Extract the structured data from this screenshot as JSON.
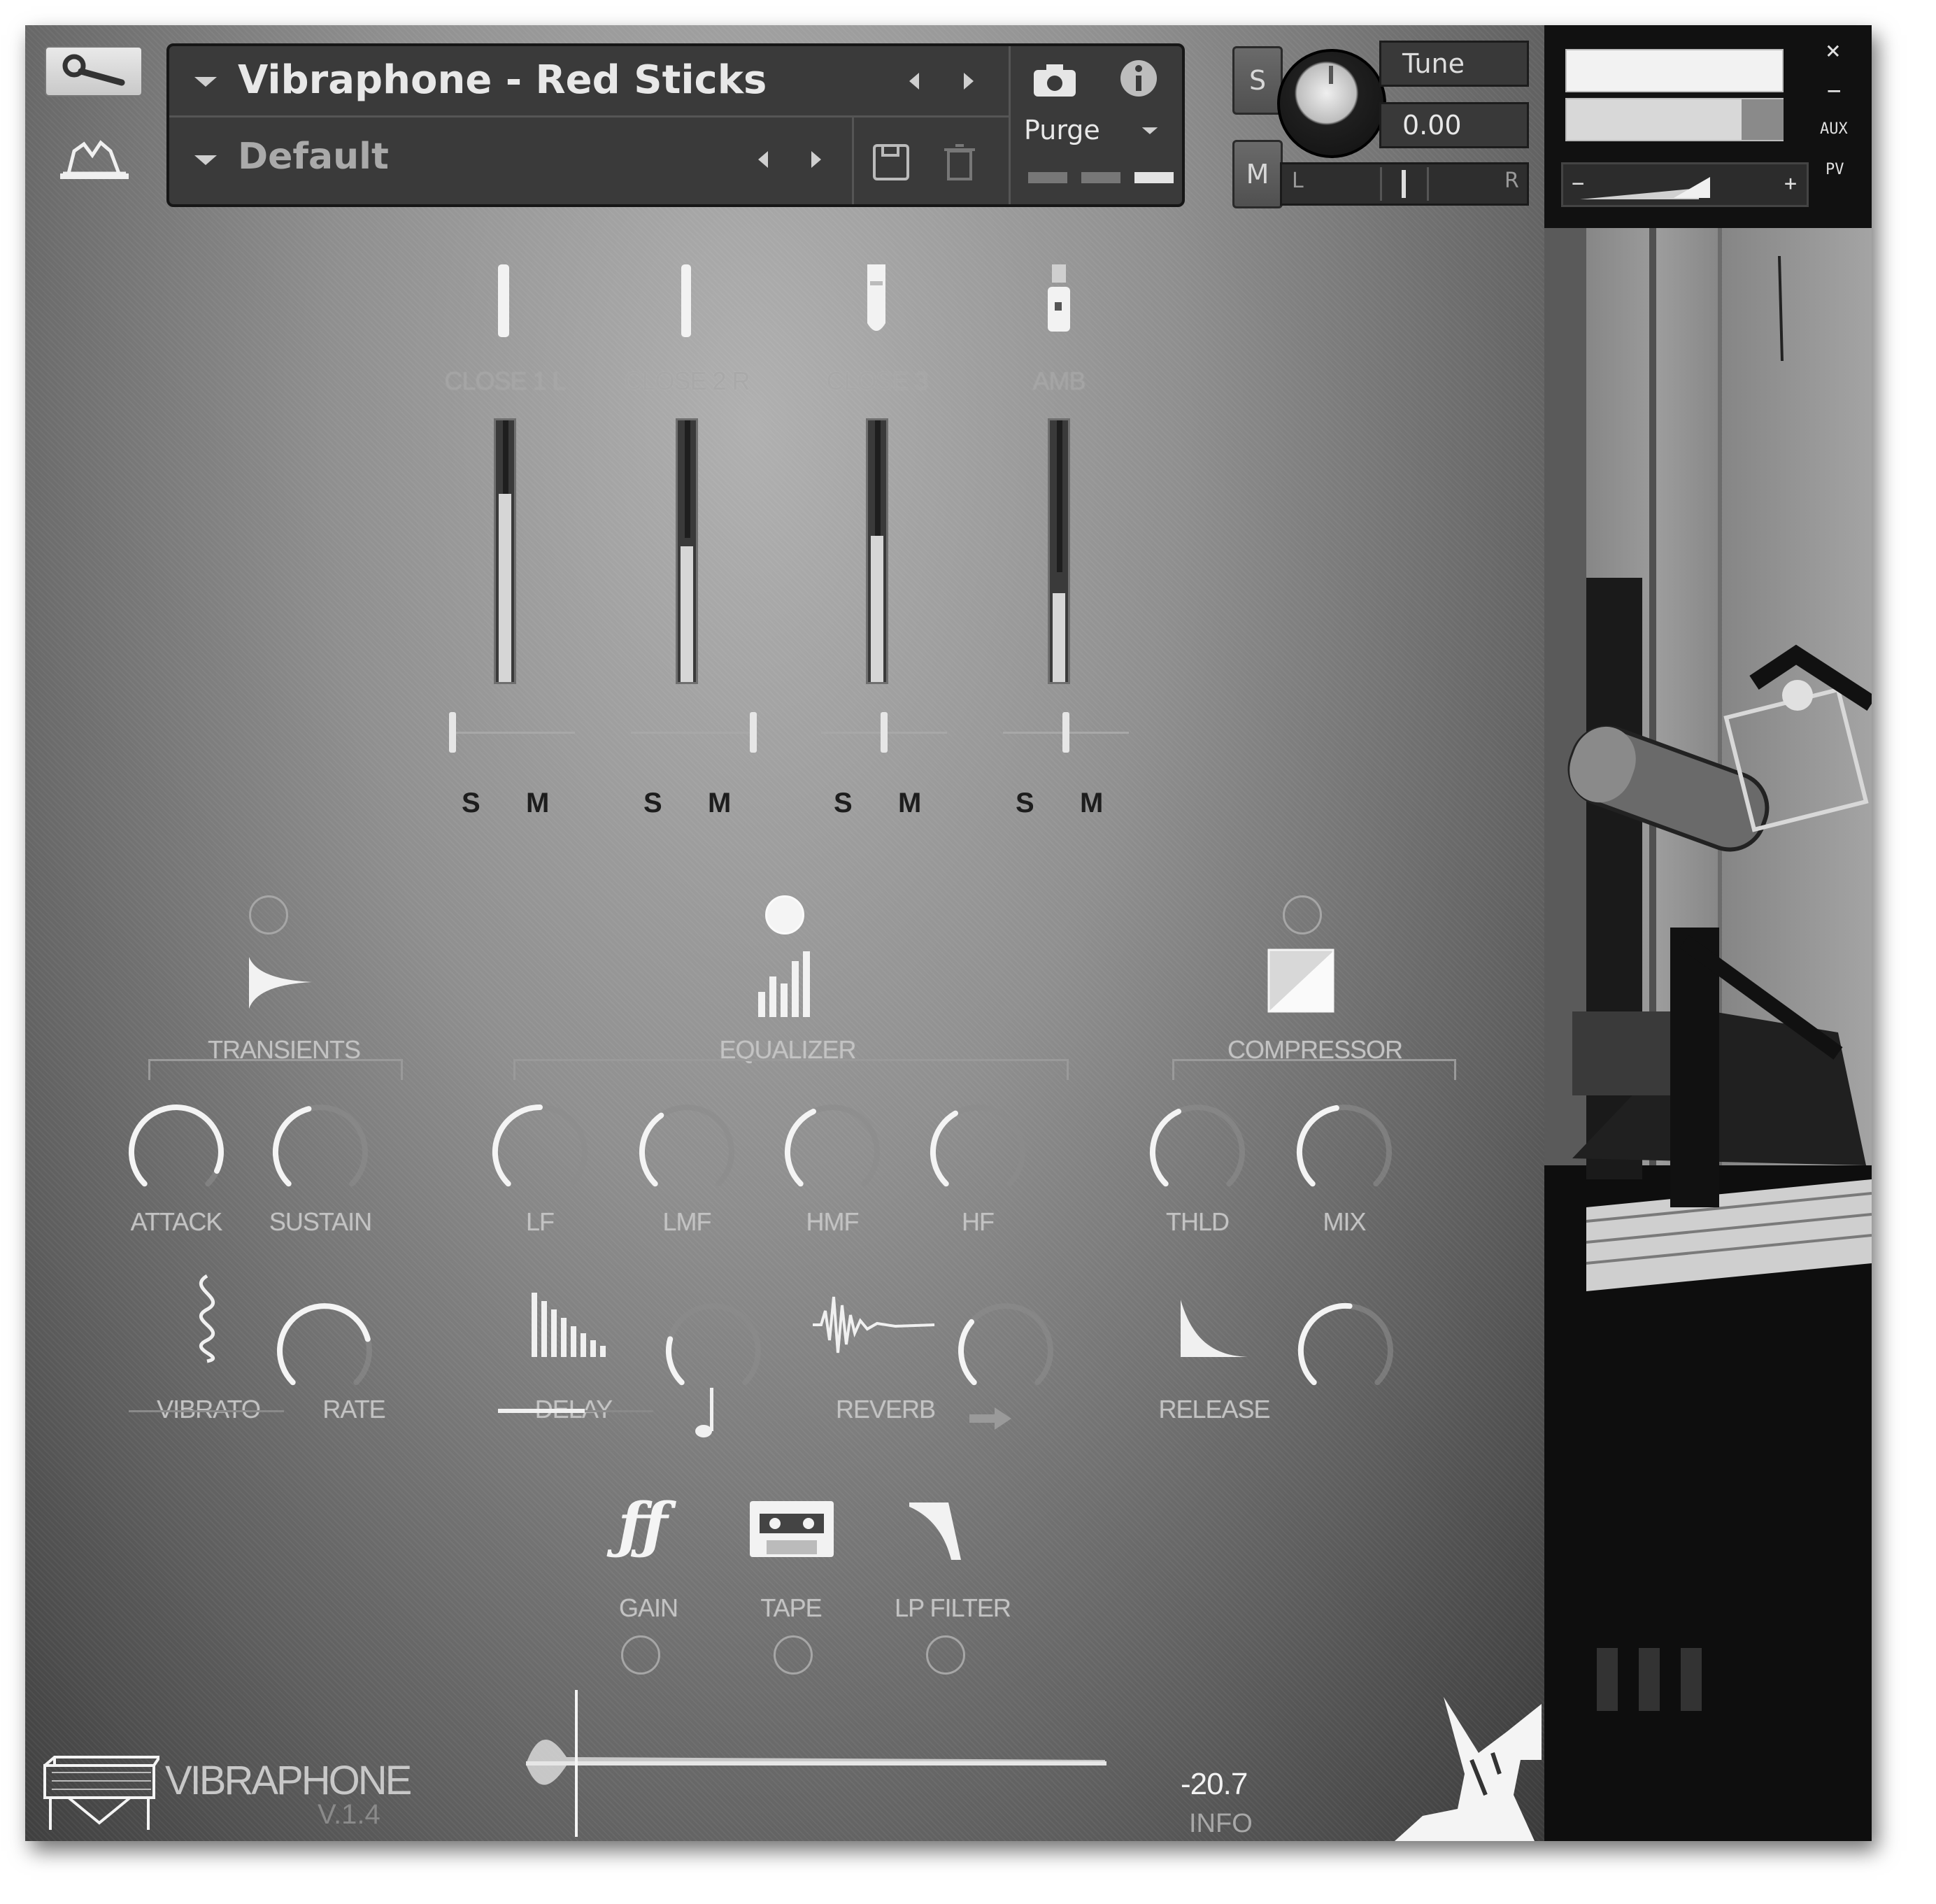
{
  "header": {
    "preset_name": "Vibraphone - Red Sticks",
    "sub_preset": "Default",
    "purge_label": "Purge",
    "solo_label": "S",
    "mute_label": "M",
    "tune_label": "Tune",
    "tune_value": "0.00",
    "pan_left": "L",
    "pan_right": "R"
  },
  "side": {
    "aux_label": "AUX",
    "pv_label": "PV",
    "close_symbol": "×",
    "minimize_symbol": "−",
    "minus_symbol": "−",
    "plus_symbol": "+"
  },
  "mixer": {
    "channels": [
      {
        "name": "CLOSE 1 L",
        "solo": "S",
        "mute": "M"
      },
      {
        "name": "CLOSE 2 R",
        "solo": "S",
        "mute": "M"
      },
      {
        "name": "CLOSE 3",
        "solo": "S",
        "mute": "M"
      },
      {
        "name": "AMB",
        "solo": "S",
        "mute": "M"
      }
    ]
  },
  "effects": {
    "transients": {
      "title": "TRANSIENTS",
      "knobs": [
        "ATTACK",
        "SUSTAIN"
      ],
      "enabled": false
    },
    "equalizer": {
      "title": "EQUALIZER",
      "knobs": [
        "LF",
        "LMF",
        "HMF",
        "HF"
      ],
      "enabled": true
    },
    "compressor": {
      "title": "COMPRESSOR",
      "knobs": [
        "THLD",
        "MIX"
      ],
      "enabled": false
    }
  },
  "modulation": {
    "vibrato": "VIBRATO",
    "rate": "RATE",
    "delay": "DELAY",
    "reverb": "REVERB",
    "release": "RELEASE"
  },
  "fx_buttons": {
    "gain": "GAIN",
    "tape": "TAPE",
    "lp_filter": "LP FILTER"
  },
  "footer": {
    "product_name": "VIBRAPHONE",
    "version": "V.1.4",
    "level_value": "-20.7",
    "info_label": "INFO"
  },
  "colors": {
    "panel_light": "#b0b0b0",
    "panel_dark": "#3a3a3a",
    "label": "#c3c3c3",
    "side_bg": "#050505"
  }
}
